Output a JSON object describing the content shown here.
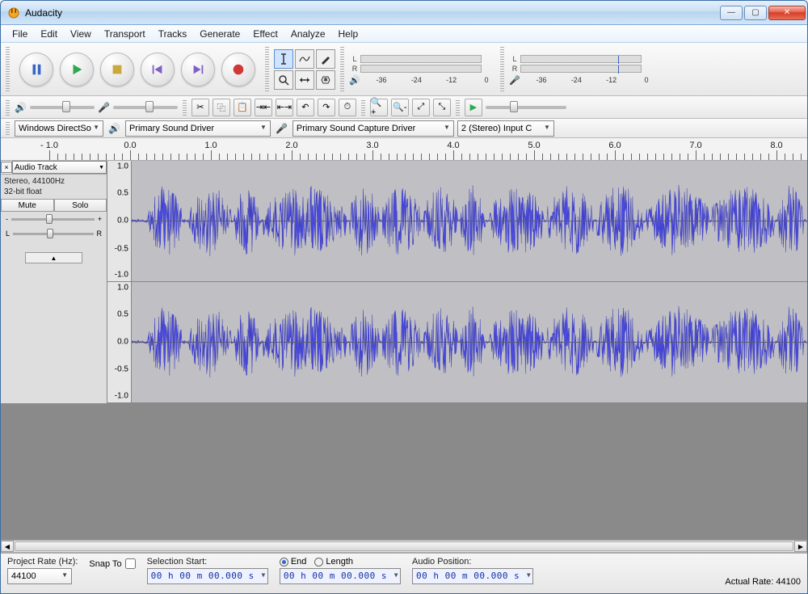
{
  "window": {
    "title": "Audacity"
  },
  "menu": [
    "File",
    "Edit",
    "View",
    "Transport",
    "Tracks",
    "Generate",
    "Effect",
    "Analyze",
    "Help"
  ],
  "meters": {
    "play": {
      "labels": [
        "L",
        "R"
      ]
    },
    "record": {
      "labels": [
        "L",
        "R"
      ]
    },
    "scale": [
      "-36",
      "-24",
      "-12",
      "0"
    ]
  },
  "devices": {
    "host": "Windows DirectSo",
    "output": "Primary Sound Driver",
    "input": "Primary Sound Capture Driver",
    "channels": "2 (Stereo) Input C"
  },
  "ruler": {
    "labels": [
      "- 1.0",
      "0.0",
      "1.0",
      "2.0",
      "3.0",
      "4.0",
      "5.0",
      "6.0",
      "7.0",
      "8.0"
    ]
  },
  "track": {
    "name": "Audio Track",
    "format1": "Stereo, 44100Hz",
    "format2": "32-bit float",
    "mute": "Mute",
    "solo": "Solo",
    "gain_left": "-",
    "gain_right": "+",
    "pan_left": "L",
    "pan_right": "R",
    "vscale": [
      "1.0",
      "0.5",
      "0.0",
      "-0.5",
      "-1.0"
    ]
  },
  "status": {
    "project_rate_lbl": "Project Rate (Hz):",
    "project_rate": "44100",
    "snap_to": "Snap To",
    "sel_start_lbl": "Selection Start:",
    "end_lbl": "End",
    "length_lbl": "Length",
    "audio_pos_lbl": "Audio Position:",
    "time_zero": "00 h 00 m 00.000 s",
    "actual_rate": "Actual Rate: 44100"
  }
}
